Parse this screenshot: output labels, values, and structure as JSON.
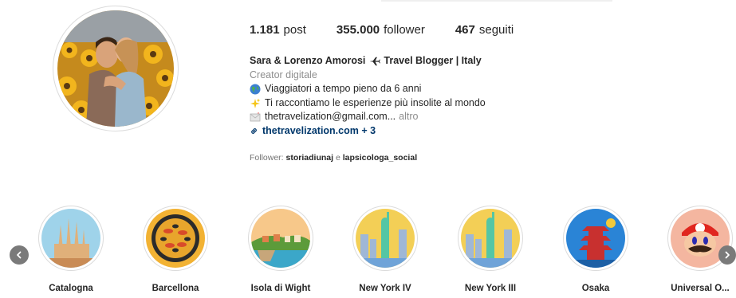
{
  "stats": {
    "posts_count": "1.181",
    "posts_label": "post",
    "followers_count": "355.000",
    "followers_label": "follower",
    "following_count": "467",
    "following_label": "seguiti"
  },
  "bio": {
    "name_part1": "Sara & Lorenzo Amorosi",
    "name_part2": "Travel Blogger | Italy",
    "category": "Creator digitale",
    "line1": "Viaggiatori a tempo pieno da 6 anni",
    "line2": "Ti raccontiamo le esperienze più insolite al mondo",
    "email": "thetravelization@gmail.com...",
    "more": "altro",
    "link": "thetravelization.com + 3"
  },
  "followed_by": {
    "prefix": "Follower:",
    "user1": "storiadiunaj",
    "conj": "e",
    "user2": "lapsicologa_social"
  },
  "highlights": [
    {
      "label": "Catalogna"
    },
    {
      "label": "Barcellona"
    },
    {
      "label": "Isola di Wight"
    },
    {
      "label": "New York IV"
    },
    {
      "label": "New York III"
    },
    {
      "label": "Osaka"
    },
    {
      "label": "Universal O..."
    }
  ],
  "icons": {
    "plane": "airplane-icon",
    "globe": "globe-emoji-icon",
    "sparkles": "sparkles-emoji-icon",
    "mail": "envelope-emoji-icon",
    "link": "link-icon",
    "prev": "chevron-left-icon",
    "next": "chevron-right-icon"
  },
  "colors": {
    "link": "#00376b",
    "secondary_text": "#8e8e8e",
    "ring": "#dbdbdb"
  }
}
